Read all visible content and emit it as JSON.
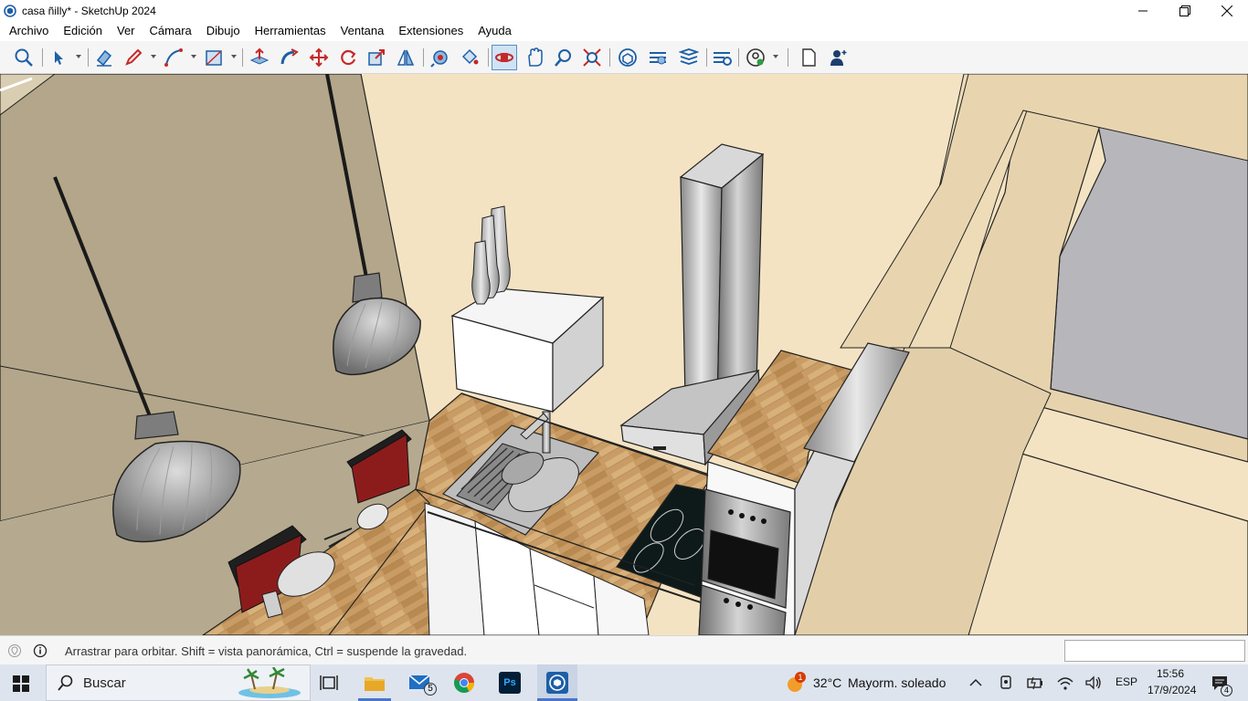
{
  "window": {
    "title": "casa ñilly* - SketchUp 2024"
  },
  "menu": {
    "items": [
      "Archivo",
      "Edición",
      "Ver",
      "Cámara",
      "Dibujo",
      "Herramientas",
      "Ventana",
      "Extensiones",
      "Ayuda"
    ]
  },
  "toolbar": {
    "tools": [
      "zoom-window-icon",
      "select-icon",
      "eraser-icon",
      "pencil-icon",
      "arc-icon",
      "rectangle-icon",
      "push-pull-icon",
      "follow-me-icon",
      "move-icon",
      "rotate-icon",
      "scale-icon",
      "flip-icon",
      "tape-measure-icon",
      "paint-bucket-icon",
      "orbit-icon",
      "pan-icon",
      "zoom-icon",
      "zoom-extents-icon",
      "warehouse-icon",
      "extension-warehouse-icon",
      "layout-icon",
      "extension-manager-icon",
      "account-icon",
      "new-file-icon",
      "profile-icon"
    ],
    "active_tool": "orbit-icon"
  },
  "status": {
    "message": "Arrastrar para orbitar. Shift = vista panorámica, Ctrl = suspende la gravedad.",
    "measurements_value": ""
  },
  "taskbar": {
    "search_placeholder": "Buscar",
    "mail_badge": "5",
    "ps_label": "Ps",
    "weather_badge": "1",
    "weather_temp": "32°C",
    "weather_desc": "Mayorm. soleado",
    "language": "ESP",
    "time": "15:56",
    "date": "17/9/2024",
    "notification_count": "4"
  },
  "colors": {
    "accent": "#4a76c9",
    "wall_left": "#b4a88c",
    "wall_back": "#f4e3c3",
    "countertop": "#c9a06a",
    "floor_gray": "#b4b4b8"
  }
}
